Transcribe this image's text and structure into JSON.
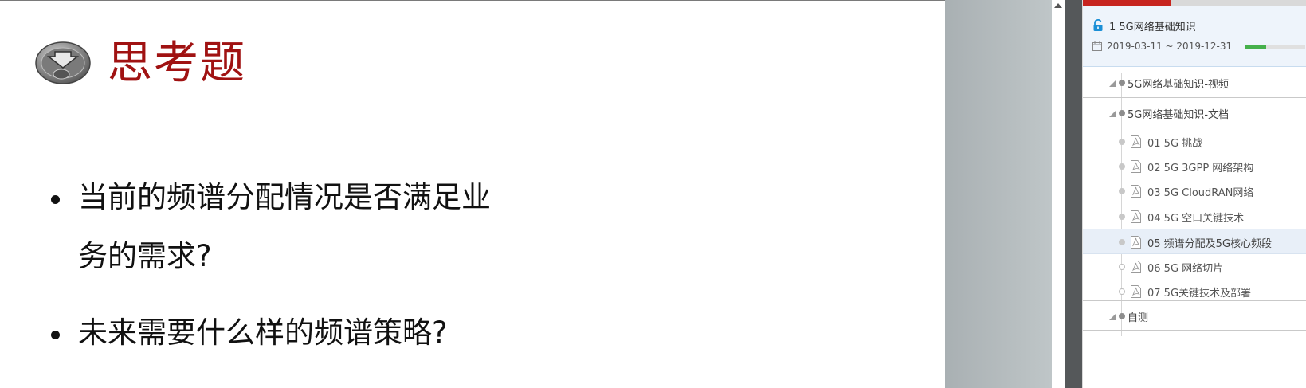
{
  "slide": {
    "title": "思考题",
    "bullets": [
      "当前的频谱分配情况是否满足业",
      "务的需求?",
      "未来需要什么样的频谱策略?"
    ],
    "title_color": "#a01212"
  },
  "sidebar": {
    "course": {
      "title": "1 5G网络基础知识",
      "dates": "2019-03-11 ~ 2019-12-31",
      "progress": 0.35,
      "progress_color": "#45b04b"
    },
    "sections": [
      {
        "label": "5G网络基础知识-视频"
      },
      {
        "label": "5G网络基础知识-文档"
      },
      {
        "label": "自测"
      }
    ],
    "items": [
      {
        "label": "01 5G 挑战",
        "icon": "pdf-icon",
        "active": false
      },
      {
        "label": "02 5G 3GPP 网络架构",
        "icon": "pdf-icon",
        "active": false
      },
      {
        "label": "03 5G CloudRAN网络",
        "icon": "pdf-icon",
        "active": false
      },
      {
        "label": "04 5G 空口关键技术",
        "icon": "pdf-icon",
        "active": false
      },
      {
        "label": "05 频谱分配及5G核心频段",
        "icon": "pdf-icon",
        "active": true
      },
      {
        "label": "06 5G 网络切片",
        "icon": "pdf-icon",
        "active": false
      },
      {
        "label": "07 5G关键技术及部署",
        "icon": "pdf-icon",
        "active": false
      }
    ],
    "accent_color": "#c7241f"
  }
}
